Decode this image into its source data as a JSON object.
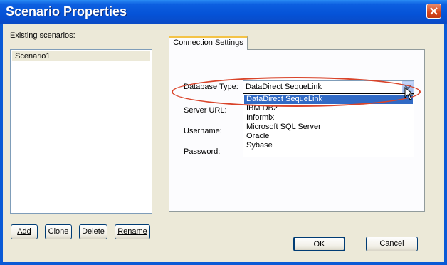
{
  "window": {
    "title": "Scenario Properties"
  },
  "scenarios": {
    "label": "Existing scenarios:",
    "items": [
      "Scenario1"
    ],
    "buttons": {
      "add": "Add",
      "clone": "Clone",
      "delete": "Delete",
      "rename": "Rename"
    }
  },
  "tab": {
    "label": "Connection Settings"
  },
  "connection": {
    "database_type_label": "Database Type:",
    "database_type_value": "DataDirect SequeLink",
    "database_options": [
      "DataDirect SequeLink",
      "IBM DB2",
      "Informix",
      "Microsoft SQL Server",
      "Oracle",
      "Sybase"
    ],
    "server_url_label": "Server URL:",
    "username_label": "Username:",
    "password_label": "Password:"
  },
  "footer": {
    "ok": "OK",
    "cancel": "Cancel"
  },
  "colors": {
    "title_bar": "#0552d7",
    "selection": "#316ac5",
    "highlight_ring": "#d9442a",
    "tab_accent": "#f4c346"
  }
}
